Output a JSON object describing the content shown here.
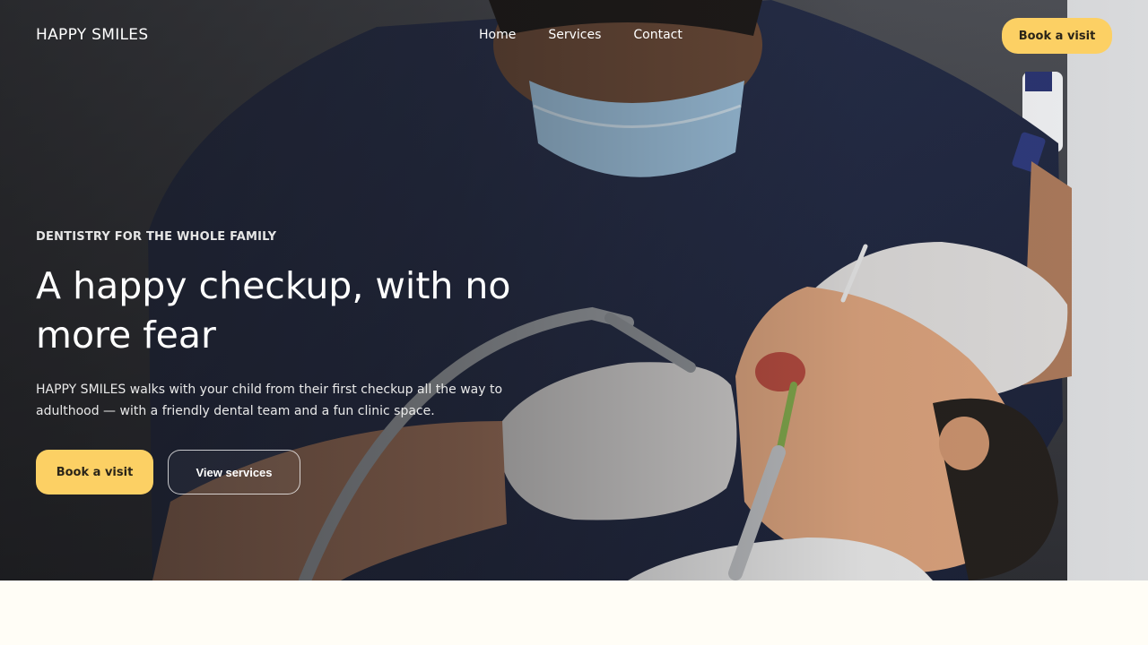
{
  "brand": {
    "name": "HAPPY SMILES"
  },
  "nav": {
    "links": [
      {
        "label": "Home"
      },
      {
        "label": "Services"
      },
      {
        "label": "Contact"
      }
    ],
    "cta_label": "Book a visit"
  },
  "hero": {
    "eyebrow": "DENTISTRY FOR THE WHOLE FAMILY",
    "headline": "A happy checkup, with no more fear",
    "lede": "HAPPY SMILES walks with your child from their first checkup all the way to adulthood — with a friendly dental team and a fun clinic space.",
    "primary_cta": "Book a visit",
    "secondary_cta": "View services",
    "photo_subject": "dentist-examining-child"
  },
  "colors": {
    "accent": "#fcd064",
    "page_background": "#fffdf6"
  }
}
